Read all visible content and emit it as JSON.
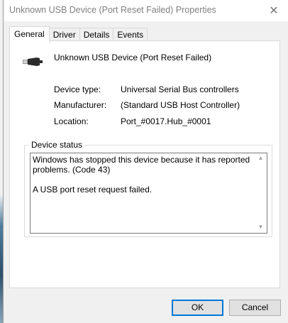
{
  "window": {
    "title": "Unknown USB Device (Port Reset Failed) Properties",
    "close_glyph": "✕"
  },
  "tabs": [
    {
      "label": "General",
      "active": true
    },
    {
      "label": "Driver",
      "active": false
    },
    {
      "label": "Details",
      "active": false
    },
    {
      "label": "Events",
      "active": false
    }
  ],
  "device": {
    "icon": "usb-connector-icon",
    "name": "Unknown USB Device (Port Reset Failed)"
  },
  "properties": [
    {
      "label": "Device type:",
      "value": "Universal Serial Bus controllers"
    },
    {
      "label": "Manufacturer:",
      "value": "(Standard USB Host Controller)"
    },
    {
      "label": "Location:",
      "value": "Port_#0017.Hub_#0001"
    }
  ],
  "status": {
    "legend": "Device status",
    "text": "Windows has stopped this device because it has reported problems. (Code 43)\n\nA USB port reset request failed."
  },
  "buttons": {
    "ok": "OK",
    "cancel": "Cancel"
  }
}
